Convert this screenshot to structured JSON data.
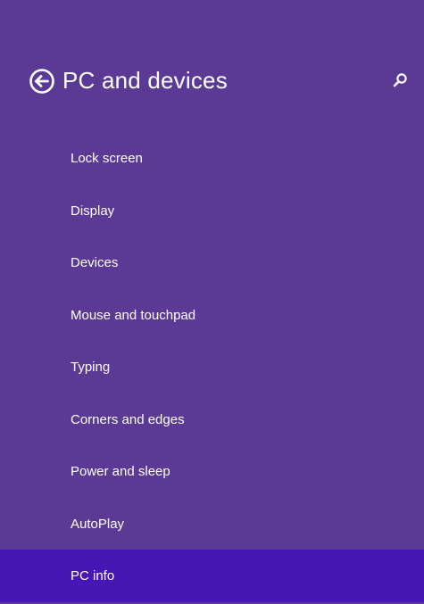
{
  "header": {
    "title": "PC and devices",
    "back_icon": "back-arrow-circle-icon",
    "search_icon": "search-icon"
  },
  "menu": {
    "items": [
      {
        "label": "Lock screen",
        "selected": false
      },
      {
        "label": "Display",
        "selected": false
      },
      {
        "label": "Devices",
        "selected": false
      },
      {
        "label": "Mouse and touchpad",
        "selected": false
      },
      {
        "label": "Typing",
        "selected": false
      },
      {
        "label": "Corners and edges",
        "selected": false
      },
      {
        "label": "Power and sleep",
        "selected": false
      },
      {
        "label": "AutoPlay",
        "selected": false
      },
      {
        "label": "PC info",
        "selected": true
      }
    ]
  },
  "colors": {
    "background": "#5b3a96",
    "selected_background": "#4617b4",
    "text": "#ffffff"
  }
}
